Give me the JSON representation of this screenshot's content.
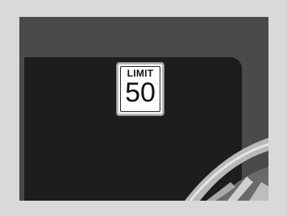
{
  "speed_limit_sign": {
    "label": "LIMIT",
    "value": "50"
  },
  "colors": {
    "frame": "#d9d9d9",
    "screen": "#4a4a4a",
    "display": "#1d1d1d",
    "sign_face": "#ffffff",
    "sign_text": "#111111"
  },
  "icons": {
    "steering_wheel": "steering-wheel-icon"
  }
}
